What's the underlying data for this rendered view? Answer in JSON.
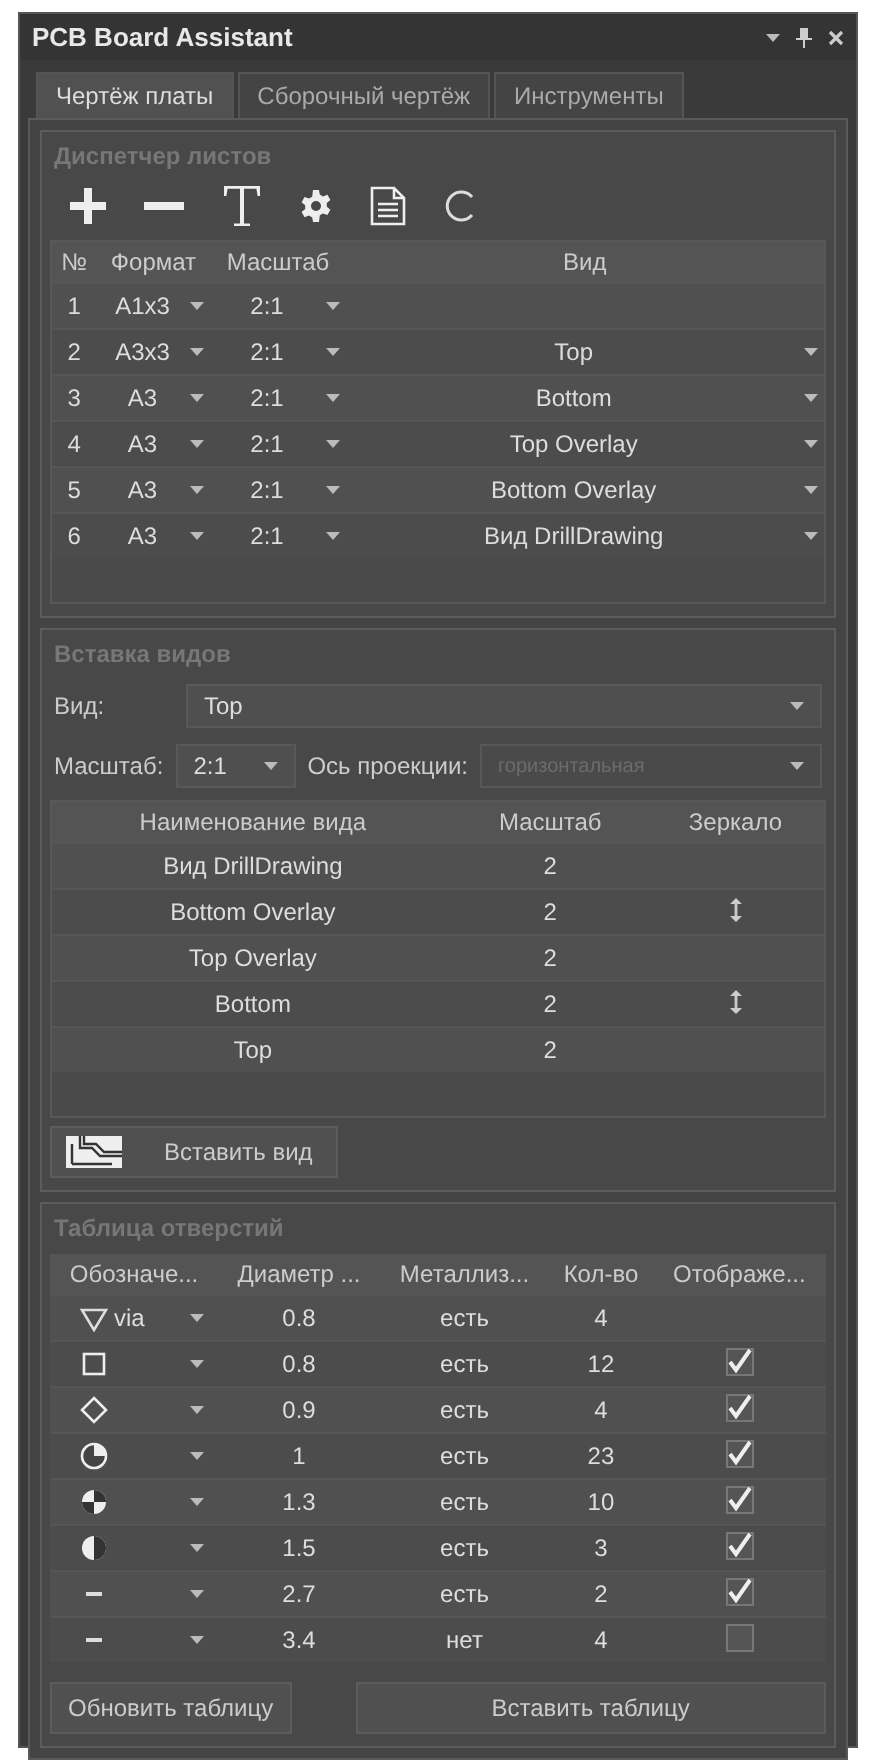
{
  "window": {
    "title": "PCB Board Assistant"
  },
  "tabs": [
    {
      "label": "Чертёж платы",
      "selected": true
    },
    {
      "label": "Сборочный чертёж",
      "selected": false
    },
    {
      "label": "Инструменты",
      "selected": false
    }
  ],
  "sheet_manager": {
    "title": "Диспетчер листов",
    "columns": [
      "№",
      "Формат",
      "Масштаб",
      "Вид"
    ],
    "rows": [
      {
        "number": "1",
        "format": "A1x3",
        "scale": "2:1"
      },
      {
        "number": "2",
        "format": "A3x3",
        "scale": "2:1",
        "view": "Top"
      },
      {
        "number": "3",
        "format": "A3",
        "scale": "2:1",
        "view": "Bottom"
      },
      {
        "number": "4",
        "format": "A3",
        "scale": "2:1",
        "view": "Top Overlay"
      },
      {
        "number": "5",
        "format": "A3",
        "scale": "2:1",
        "view": "Bottom Overlay"
      },
      {
        "number": "6",
        "format": "A3",
        "scale": "2:1",
        "view": "Вид DrillDrawing"
      }
    ]
  },
  "view_insert": {
    "title": "Вставка видов",
    "view_label": "Вид:",
    "view_value": "Top",
    "scale_label": "Масштаб:",
    "scale_value": "2:1",
    "axis_label": "Ось проекции:",
    "axis_value": "горизонтальная",
    "axis_disabled": true,
    "columns": [
      "Наименование вида",
      "Масштаб",
      "Зеркало"
    ],
    "rows": [
      {
        "name": "Вид DrillDrawing",
        "scale": "2",
        "mirror": false
      },
      {
        "name": "Bottom Overlay",
        "scale": "2",
        "mirror": true
      },
      {
        "name": "Top Overlay",
        "scale": "2",
        "mirror": false
      },
      {
        "name": "Bottom",
        "scale": "2",
        "mirror": true
      },
      {
        "name": "Top",
        "scale": "2",
        "mirror": false
      }
    ],
    "insert_button": "Вставить вид"
  },
  "hole_table": {
    "title": "Таблица отверстий",
    "columns": [
      "Обозначе...",
      "Диаметр ...",
      "Металлиз...",
      "Кол-во",
      "Отображе..."
    ],
    "rows": [
      {
        "kind": "via",
        "symbol": "via",
        "diameter": "0.8",
        "plated": "есть",
        "count": "4"
      },
      {
        "kind": "square",
        "diameter": "0.8",
        "plated": "есть",
        "count": "12",
        "checked": true
      },
      {
        "kind": "diamond",
        "diameter": "0.9",
        "plated": "есть",
        "count": "4",
        "checked": true
      },
      {
        "kind": "quarter",
        "diameter": "1",
        "plated": "есть",
        "count": "23",
        "checked": true
      },
      {
        "kind": "quad",
        "diameter": "1.3",
        "plated": "есть",
        "count": "10",
        "checked": true
      },
      {
        "kind": "half",
        "diameter": "1.5",
        "plated": "есть",
        "count": "3",
        "checked": true
      },
      {
        "kind": "dash",
        "diameter": "2.7",
        "plated": "есть",
        "count": "2",
        "checked": true
      },
      {
        "kind": "dash",
        "diameter": "3.4",
        "plated": "нет",
        "count": "4",
        "checked": false
      }
    ],
    "buttons": [
      "Обновить таблицу",
      "Вставить таблицу"
    ]
  }
}
